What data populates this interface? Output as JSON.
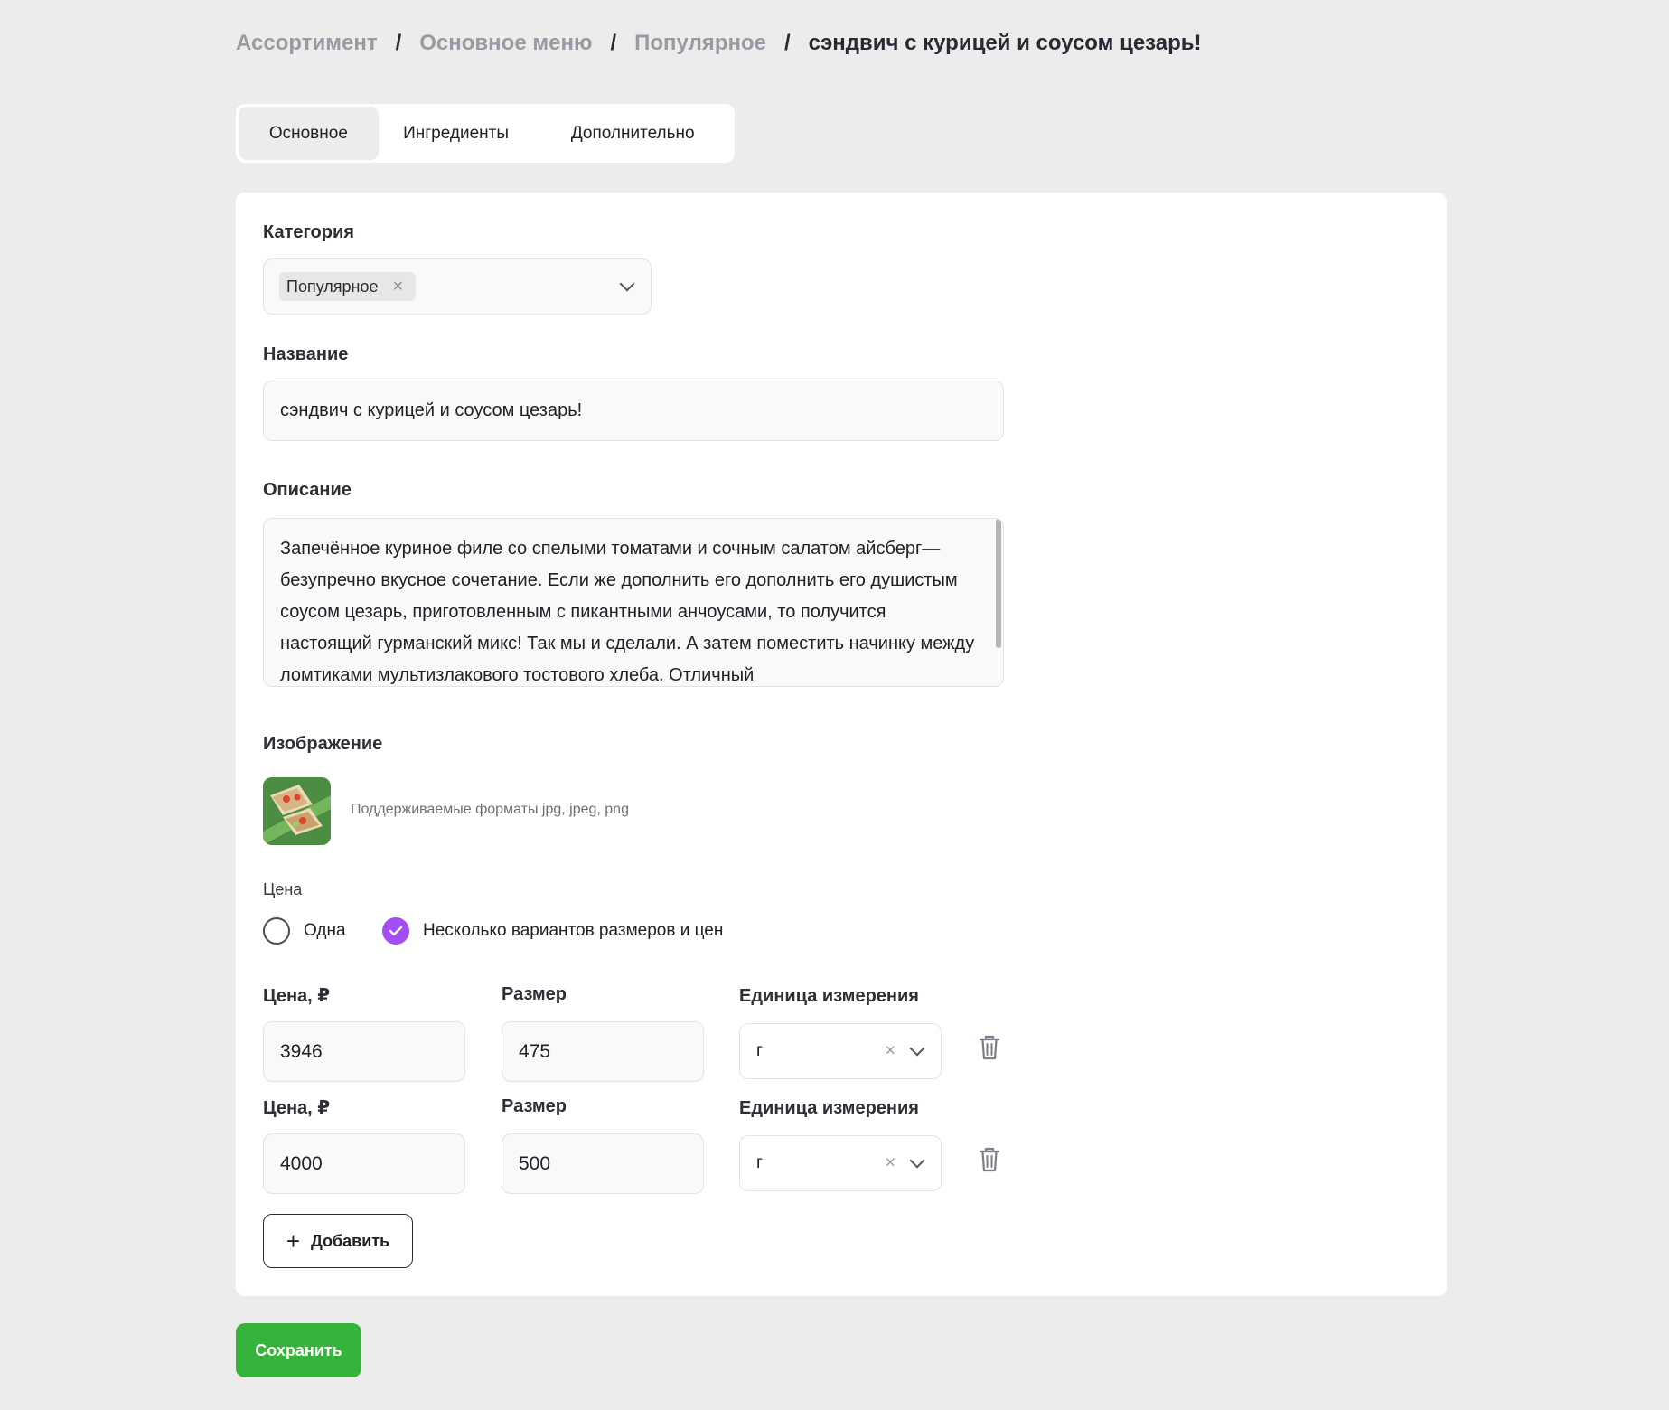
{
  "breadcrumb": {
    "items": [
      "Ассортимент",
      "Основное меню",
      "Популярное"
    ],
    "separator": "/",
    "current": "сэндвич с курицей и соусом цезарь!"
  },
  "tabs": [
    "Основное",
    "Ингредиенты",
    "Дополнительно"
  ],
  "form": {
    "category_label": "Категория",
    "category_value": "Популярное",
    "name_label": "Название",
    "name_value": "сэндвич с курицей и соусом цезарь!",
    "description_label": "Описание",
    "description_value": "Запечённое куриное филе со спелыми томатами и сочным салатом айсберг— безупречно вкусное сочетание. Если же дополнить его дополнить его душистым соусом цезарь, приготовленным с пикантными анчоусами, то получится настоящий гурманский микс! Так мы и сделали. А затем поместить начинку между ломтиками мультизлакового тостового хлеба. Отличный",
    "image_label": "Изображение",
    "image_hint": "Поддерживаемые форматы jpg, jpeg, png",
    "price_caption": "Цена",
    "price_option_single": "Одна",
    "price_option_multiple": "Несколько вариантов размеров и цен",
    "variants": [
      {
        "price_label": "Цена, ₽",
        "price": "3946",
        "size_label": "Размер",
        "size": "475",
        "unit_label": "Единица измерения",
        "unit": "г"
      },
      {
        "price_label": "Цена, ₽",
        "price": "4000",
        "size_label": "Размер",
        "size": "500",
        "unit_label": "Единица измерения",
        "unit": "г"
      }
    ],
    "add_label": "Добавить"
  },
  "save_label": "Сохранить",
  "colors": {
    "accent_purple": "#a24ef3",
    "save_green": "#36b33b",
    "background": "#ececec"
  }
}
